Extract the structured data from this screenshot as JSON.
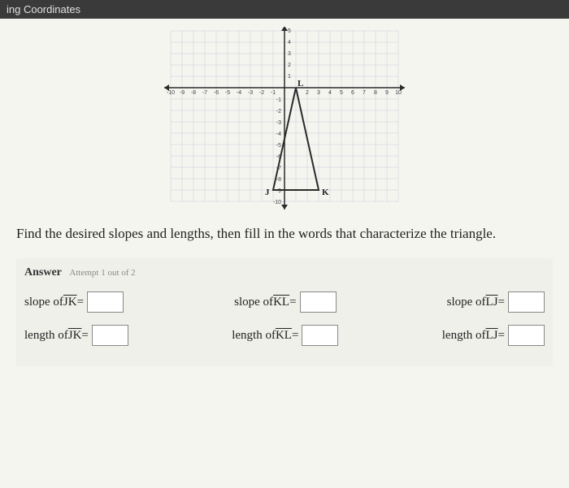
{
  "header": {
    "title": "ing Coordinates"
  },
  "chart_data": {
    "type": "scatter",
    "title": "",
    "xlabel": "",
    "ylabel": "",
    "xlim": [
      -10,
      10
    ],
    "ylim": [
      -10,
      5
    ],
    "x_ticks": [
      -10,
      -9,
      -8,
      -7,
      -6,
      -5,
      -4,
      -3,
      -2,
      -1,
      2,
      3,
      4,
      5,
      6,
      7,
      8,
      9,
      10
    ],
    "y_ticks_pos": [
      1,
      2,
      3,
      4,
      5
    ],
    "y_ticks_neg": [
      -1,
      -2,
      -3,
      -4,
      -5,
      -6,
      -7,
      -8,
      -9,
      -10
    ],
    "points": [
      {
        "name": "J",
        "x": -1,
        "y": -9
      },
      {
        "name": "K",
        "x": 3,
        "y": -9
      },
      {
        "name": "L",
        "x": 1,
        "y": 0
      }
    ],
    "triangle": [
      [
        -1,
        -9
      ],
      [
        3,
        -9
      ],
      [
        1,
        0
      ]
    ]
  },
  "question": "Find the desired slopes and lengths, then fill in the words that characterize the triangle.",
  "answer": {
    "label": "Answer",
    "attempt": "Attempt 1 out of 2",
    "fields": {
      "slope_jk": {
        "label_pre": "slope of ",
        "seg": "JK",
        "label_post": " = "
      },
      "slope_kl": {
        "label_pre": "slope of ",
        "seg": "KL",
        "label_post": " = "
      },
      "slope_lj": {
        "label_pre": "slope of ",
        "seg": "LJ",
        "label_post": " = "
      },
      "length_jk": {
        "label_pre": "length of ",
        "seg": "JK",
        "label_post": " = "
      },
      "length_kl": {
        "label_pre": "length of ",
        "seg": "KL",
        "label_post": " = "
      },
      "length_lj": {
        "label_pre": "length of ",
        "seg": "LJ",
        "label_post": " = "
      }
    }
  }
}
